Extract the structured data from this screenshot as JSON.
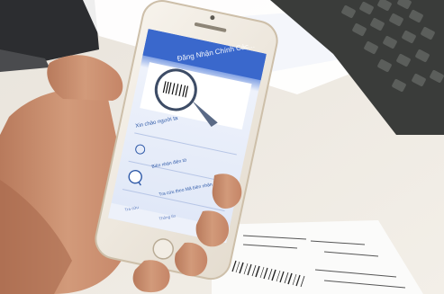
{
  "phone_screen": {
    "title": "Đăng Nhận Chính Các...",
    "greeting": "Xin chào người ta",
    "menu_item_1": "Biên nhận điện tử",
    "menu_item_2": "Tra cứu theo Mã biên nhận",
    "tab_1": "Tra cứu",
    "tab_2": "Thông tin"
  }
}
